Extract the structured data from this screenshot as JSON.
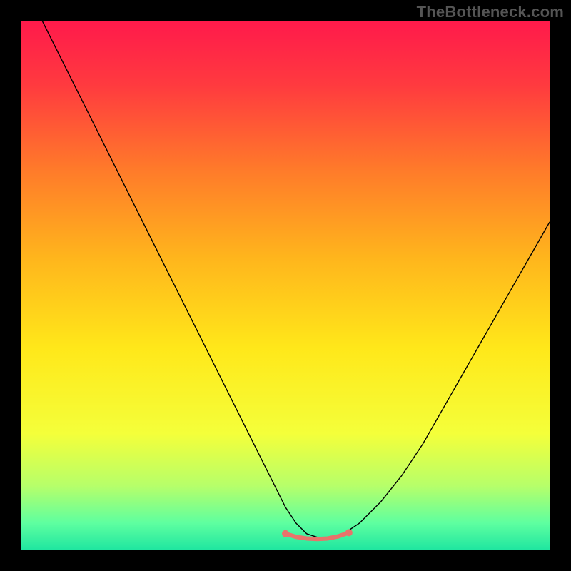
{
  "watermark": "TheBottleneck.com",
  "chart_data": {
    "type": "line",
    "title": "",
    "xlabel": "",
    "ylabel": "",
    "xlim": [
      0,
      100
    ],
    "ylim": [
      0,
      100
    ],
    "grid": false,
    "legend": false,
    "background_gradient": {
      "stops": [
        {
          "offset": 0.0,
          "color": "#ff1a4b"
        },
        {
          "offset": 0.12,
          "color": "#ff3a3f"
        },
        {
          "offset": 0.28,
          "color": "#ff7a2a"
        },
        {
          "offset": 0.45,
          "color": "#ffb61c"
        },
        {
          "offset": 0.62,
          "color": "#ffe81a"
        },
        {
          "offset": 0.78,
          "color": "#f4ff3a"
        },
        {
          "offset": 0.88,
          "color": "#b6ff6a"
        },
        {
          "offset": 0.95,
          "color": "#5effa0"
        },
        {
          "offset": 1.0,
          "color": "#20e6a0"
        }
      ]
    },
    "series": [
      {
        "name": "curve",
        "color": "#000000",
        "width": 1.4,
        "x": [
          4,
          8,
          12,
          16,
          20,
          24,
          28,
          32,
          36,
          40,
          44,
          48,
          50,
          52,
          54,
          57,
          59,
          61,
          64,
          68,
          72,
          76,
          80,
          84,
          88,
          92,
          96,
          100
        ],
        "y": [
          100,
          92,
          84,
          76,
          68,
          60,
          52,
          44,
          36,
          28,
          20,
          12,
          8,
          5,
          3,
          2,
          2,
          3,
          5,
          9,
          14,
          20,
          27,
          34,
          41,
          48,
          55,
          62
        ]
      },
      {
        "name": "bottom-band",
        "color": "#e8736b",
        "width": 6,
        "x": [
          50,
          52,
          54,
          56,
          58,
          60,
          62
        ],
        "y": [
          3.0,
          2.4,
          2.1,
          2.0,
          2.1,
          2.5,
          3.2
        ]
      }
    ],
    "markers": [
      {
        "name": "band-start",
        "x": 50,
        "y": 3.0,
        "color": "#e8736b",
        "r": 5
      },
      {
        "name": "band-end",
        "x": 62,
        "y": 3.2,
        "color": "#e8736b",
        "r": 5
      }
    ]
  }
}
